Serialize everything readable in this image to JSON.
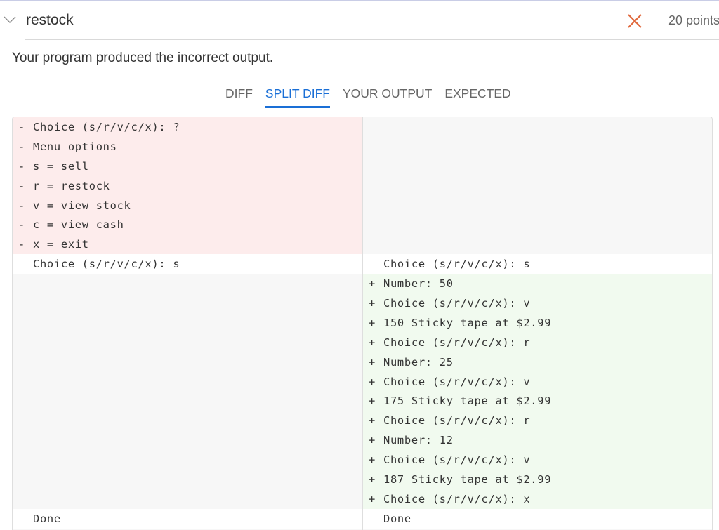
{
  "header": {
    "title": "restock",
    "points": "20 points",
    "status_icon": "close-x-icon",
    "status_color": "#e0673a"
  },
  "message": "Your program produced the incorrect output.",
  "tabs": [
    {
      "label": "DIFF",
      "active": false
    },
    {
      "label": "SPLIT DIFF",
      "active": true
    },
    {
      "label": "YOUR OUTPUT",
      "active": false
    },
    {
      "label": "EXPECTED",
      "active": false
    }
  ],
  "diff": {
    "rows": [
      {
        "type": "removed",
        "left": "Choice (s/r/v/c/x): ?",
        "right": null
      },
      {
        "type": "removed",
        "left": "Menu options",
        "right": null
      },
      {
        "type": "removed",
        "left": "s = sell",
        "right": null
      },
      {
        "type": "removed",
        "left": "r = restock",
        "right": null
      },
      {
        "type": "removed",
        "left": "v = view stock",
        "right": null
      },
      {
        "type": "removed",
        "left": "c = view cash",
        "right": null
      },
      {
        "type": "removed",
        "left": "x = exit",
        "right": null
      },
      {
        "type": "same",
        "left": "Choice (s/r/v/c/x): s",
        "right": "Choice (s/r/v/c/x): s"
      },
      {
        "type": "added",
        "left": null,
        "right": "Number: 50"
      },
      {
        "type": "added",
        "left": null,
        "right": "Choice (s/r/v/c/x): v"
      },
      {
        "type": "added",
        "left": null,
        "right": "150 Sticky tape at $2.99"
      },
      {
        "type": "added",
        "left": null,
        "right": "Choice (s/r/v/c/x): r"
      },
      {
        "type": "added",
        "left": null,
        "right": "Number: 25"
      },
      {
        "type": "added",
        "left": null,
        "right": "Choice (s/r/v/c/x): v"
      },
      {
        "type": "added",
        "left": null,
        "right": "175 Sticky tape at $2.99"
      },
      {
        "type": "added",
        "left": null,
        "right": "Choice (s/r/v/c/x): r"
      },
      {
        "type": "added",
        "left": null,
        "right": "Number: 12"
      },
      {
        "type": "added",
        "left": null,
        "right": "Choice (s/r/v/c/x): v"
      },
      {
        "type": "added",
        "left": null,
        "right": "187 Sticky tape at $2.99"
      },
      {
        "type": "added",
        "left": null,
        "right": "Choice (s/r/v/c/x): x"
      },
      {
        "type": "same",
        "left": "Done",
        "right": "Done"
      }
    ],
    "removed_marker": "-",
    "added_marker": "+"
  }
}
